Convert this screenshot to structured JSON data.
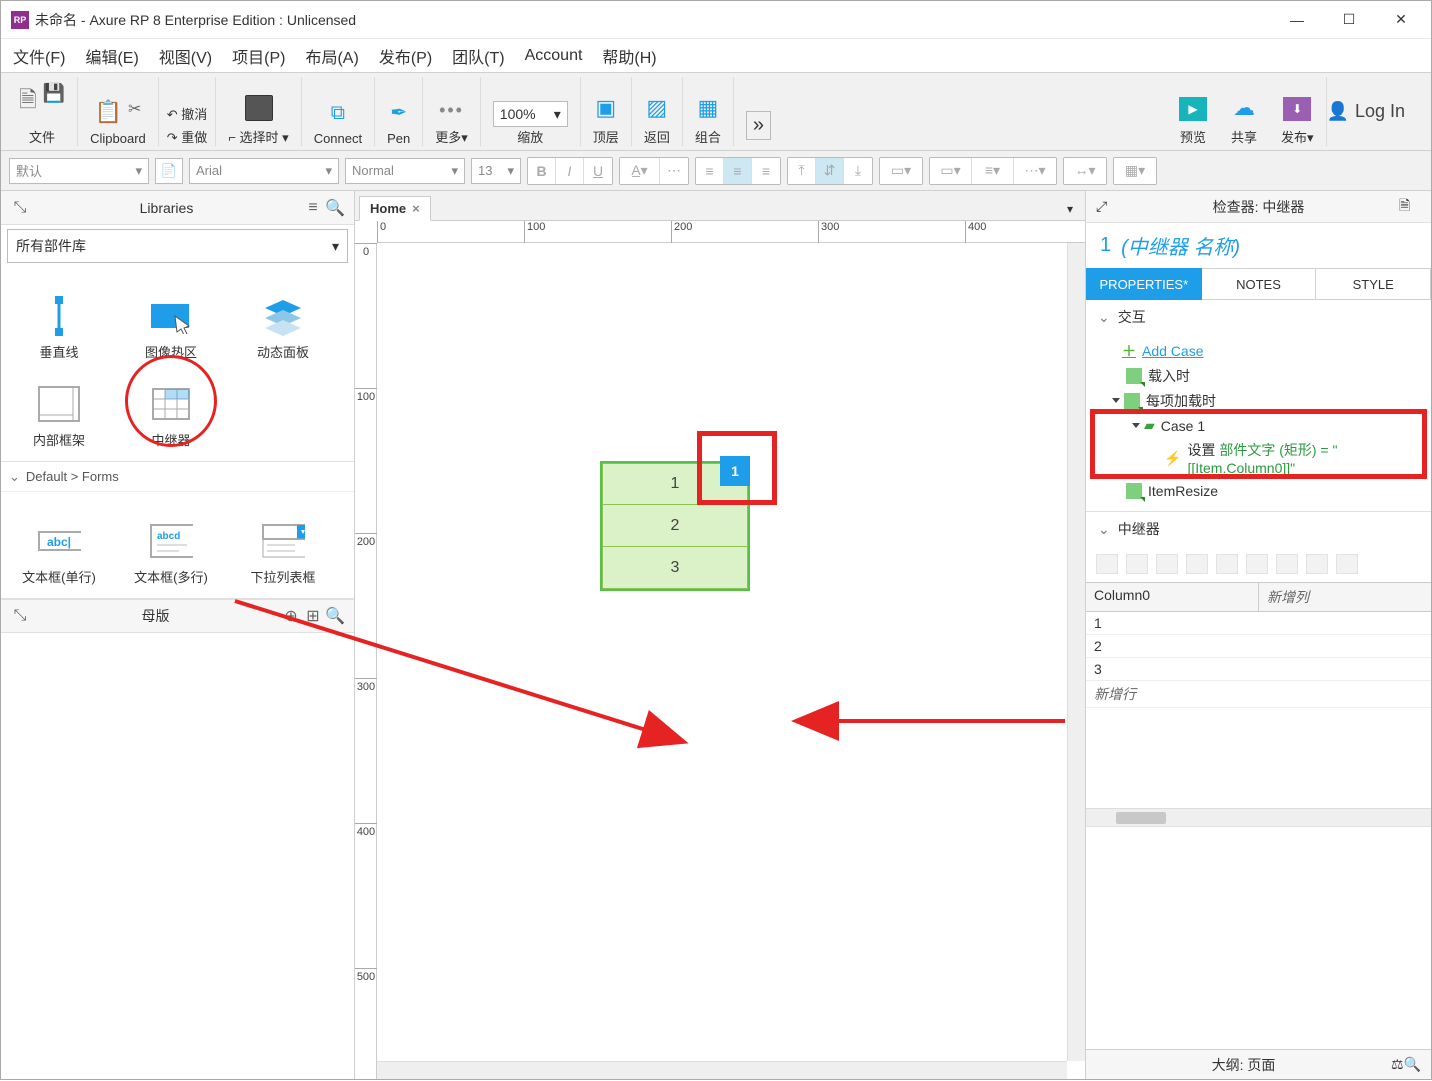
{
  "title": "未命名 - Axure RP 8 Enterprise Edition : Unlicensed",
  "menu": [
    "文件(F)",
    "编辑(E)",
    "视图(V)",
    "项目(P)",
    "布局(A)",
    "发布(P)",
    "团队(T)",
    "Account",
    "帮助(H)"
  ],
  "toolbar": {
    "file": "文件",
    "clipboard": "Clipboard",
    "undo": "撤消",
    "redo": "重做",
    "select": "选择时",
    "connect": "Connect",
    "pen": "Pen",
    "more": "更多",
    "zoom_val": "100%",
    "zoom": "缩放",
    "top": "顶层",
    "back": "返回",
    "group": "组合",
    "preview": "预览",
    "share": "共享",
    "publish": "发布",
    "login": "Log In"
  },
  "fmt": {
    "preset": "默认",
    "font": "Arial",
    "weight": "Normal",
    "size": "13"
  },
  "left": {
    "libraries": "Libraries",
    "all_widgets": "所有部件库",
    "w1": "垂直线",
    "w2": "图像热区",
    "w3": "动态面板",
    "w4": "内部框架",
    "w5": "中继器",
    "forms_header": "Default > Forms",
    "f1": "文本框(单行)",
    "f2": "文本框(多行)",
    "f3": "下拉列表框",
    "masters": "母版"
  },
  "tabs": {
    "home": "Home"
  },
  "ruler_h": [
    "0",
    "100",
    "200",
    "300",
    "400"
  ],
  "ruler_v": [
    "0",
    "100",
    "200",
    "300",
    "400",
    "500"
  ],
  "repeater_rows": [
    "1",
    "2",
    "3"
  ],
  "handle": "1",
  "right": {
    "inspector": "检查器: 中继器",
    "num": "1",
    "name": "(中继器 名称)",
    "tab_props": "PROPERTIES",
    "tab_notes": "NOTES",
    "tab_style": "STYLE",
    "sec_interact": "交互",
    "add_case": "Add Case",
    "ev_load": "载入时",
    "ev_itemload": "每项加载时",
    "case1": "Case 1",
    "action_prefix": "设置 ",
    "action_green": "部件文字 (矩形) = \"[[Item.Column0]]\"",
    "ev_resize": "ItemResize",
    "sec_repeater": "中继器",
    "col0": "Column0",
    "newcol": "新增列",
    "rows": [
      "1",
      "2",
      "3"
    ],
    "newrow": "新增行",
    "outline": "大纲: 页面"
  }
}
